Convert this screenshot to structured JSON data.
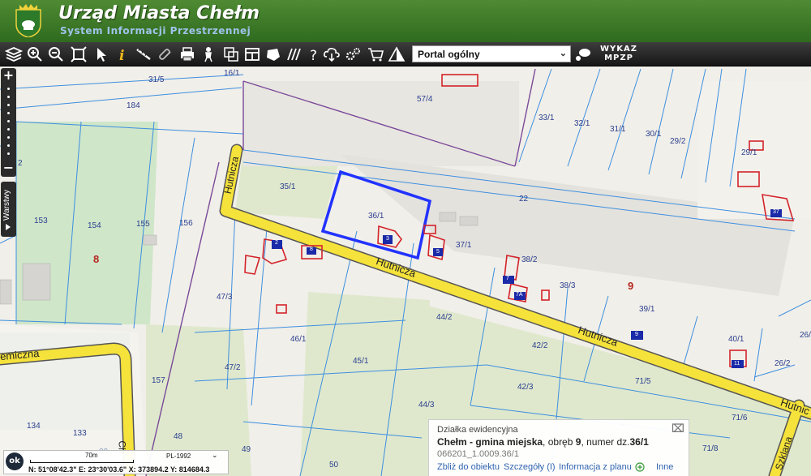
{
  "header": {
    "title": "Urząd Miasta Chełm",
    "subtitle": "System Informacji Przestrzennej"
  },
  "toolbar": {
    "tools": [
      "layers-icon",
      "zoom-in-icon",
      "zoom-out-icon",
      "zoom-extent-icon",
      "pointer-icon",
      "info-icon",
      "measure-icon",
      "link-icon",
      "print-icon",
      "pan-person-icon",
      "copy-icon",
      "layout-icon",
      "shape-icon",
      "hatch-icon",
      "help-icon",
      "cloud-download-icon",
      "settings-icon",
      "cart-icon",
      "warning-icon"
    ],
    "portal_select": "Portal ogólny",
    "wykaz_line1": "WYKAZ",
    "wykaz_line2": "MPZP"
  },
  "sidebar": {
    "zoom_in": "+",
    "zoom_out": "−",
    "layers_tab": "Warstwy"
  },
  "map": {
    "parcels": [
      "31/5",
      "16/1",
      "184",
      "57/4",
      "33/1",
      "32/1",
      "31/1",
      "30/1",
      "29/2",
      "29/1",
      "35/1",
      "36/1",
      "22",
      "37/1",
      "153",
      "154",
      "155",
      "156",
      "38/2",
      "38/3",
      "39/1",
      "47/3",
      "44/2",
      "46/1",
      "42/2",
      "40/1",
      "26/",
      "45/1",
      "47/2",
      "42/3",
      "71/5",
      "26/2",
      "157",
      "44/3",
      "71/6",
      "134",
      "133",
      "48",
      "49",
      "50",
      "71/8",
      "2",
      "32"
    ],
    "precincts": [
      "8",
      "9"
    ],
    "streets": [
      "Hutnicza",
      "Hutnicza",
      "Hutnicza",
      "emiczna",
      "Szklana",
      "Hutnic",
      "Ch"
    ],
    "building_numbers": [
      "2",
      "8",
      "3",
      "5",
      "7",
      "7A",
      "9",
      "11",
      "37"
    ]
  },
  "info_popup": {
    "heading": "Działka ewidencyjna",
    "place": "Chełm - gmina miejska",
    "sep1": ", obręb ",
    "precinct": "9",
    "sep2": ", numer dz.",
    "parcel": "36/1",
    "parcel_id": "066201_1.0009.36/1",
    "links": [
      "Zbliż do obiektu",
      "Szczegóły (I)",
      "Informacja z planu",
      "Inne"
    ]
  },
  "status": {
    "ok": "ok",
    "scale": "70m",
    "crs": "PL-1992",
    "coords": "N: 51°08'42.3\"  E: 23°30'03.6\"  X: 373894.2  Y: 814684.3"
  },
  "colors": {
    "header": "#3f7c2a",
    "street": "#f5e23a",
    "parcel_line": "#3d8fe0",
    "selected": "#2233ff",
    "building": "#d3232a",
    "building_fill": "#1a2aa8"
  }
}
